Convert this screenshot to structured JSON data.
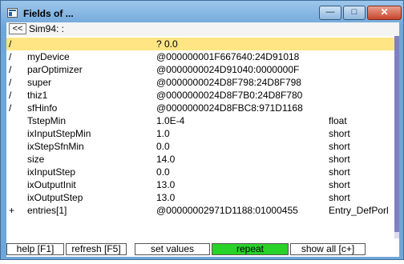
{
  "window": {
    "title": "Fields of ..."
  },
  "window_buttons": {
    "minimize": "—",
    "maximize": "□",
    "close": "✕"
  },
  "path_bar": {
    "back_label": "<<",
    "path": "Sim94: :"
  },
  "colors": {
    "highlight_row": "#ffe583",
    "repeat_button": "#28d228",
    "title_bar": "#73a9db"
  },
  "fields": [
    {
      "marker": "/",
      "name": "",
      "value": "? 0.0",
      "type": ""
    },
    {
      "marker": "/",
      "name": "myDevice",
      "value": "@000000001F667640:24D91018",
      "type": ""
    },
    {
      "marker": "/",
      "name": "parOptimizer",
      "value": "@0000000024D91040:0000000F",
      "type": ""
    },
    {
      "marker": "/",
      "name": "super",
      "value": "@0000000024D8F798:24D8F798",
      "type": ""
    },
    {
      "marker": "/",
      "name": "thiz1",
      "value": "@0000000024D8F7B0:24D8F780",
      "type": ""
    },
    {
      "marker": "/",
      "name": "sfHinfo",
      "value": "@0000000024D8FBC8:971D1168",
      "type": ""
    },
    {
      "marker": "",
      "name": "TstepMin",
      "value": "1.0E-4",
      "type": "float"
    },
    {
      "marker": "",
      "name": "ixInputStepMin",
      "value": "1.0",
      "type": "short"
    },
    {
      "marker": "",
      "name": "ixStepSfnMin",
      "value": "0.0",
      "type": "short"
    },
    {
      "marker": "",
      "name": "size",
      "value": "14.0",
      "type": "short"
    },
    {
      "marker": "",
      "name": "ixInputStep",
      "value": "0.0",
      "type": "short"
    },
    {
      "marker": "",
      "name": "ixOutputInit",
      "value": "13.0",
      "type": "short"
    },
    {
      "marker": "",
      "name": "ixOutputStep",
      "value": "13.0",
      "type": "short"
    },
    {
      "marker": "+",
      "name": "entries[1]",
      "value": "@00000002971D1188:01000455",
      "type": "Entry_DefPorl"
    }
  ],
  "buttons": {
    "help": "help [F1]",
    "refresh": "refresh [F5]",
    "set_values": "set values",
    "repeat": "repeat",
    "show_all": "show all [c+]"
  }
}
